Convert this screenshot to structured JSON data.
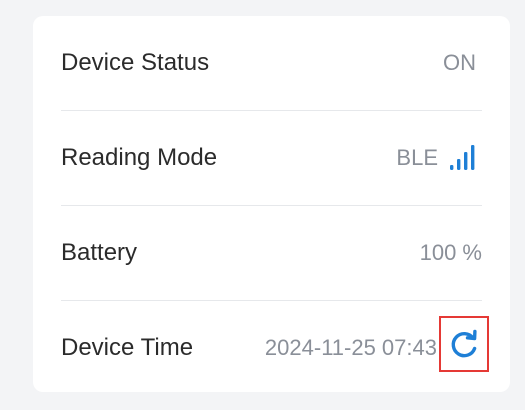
{
  "device_info": {
    "rows": [
      {
        "label": "Device Status",
        "value": "ON"
      },
      {
        "label": "Reading Mode",
        "value": "BLE",
        "icon": "signal-bars-icon"
      },
      {
        "label": "Battery",
        "value": "100 %"
      },
      {
        "label": "Device Time",
        "value": "2024-11-25 07:43",
        "action_icon": "refresh-icon"
      }
    ]
  },
  "colors": {
    "accent": "#1e7fd6",
    "highlight_border": "#e53935",
    "value_text": "#8a8f98",
    "label_text": "#2b2b2b"
  }
}
